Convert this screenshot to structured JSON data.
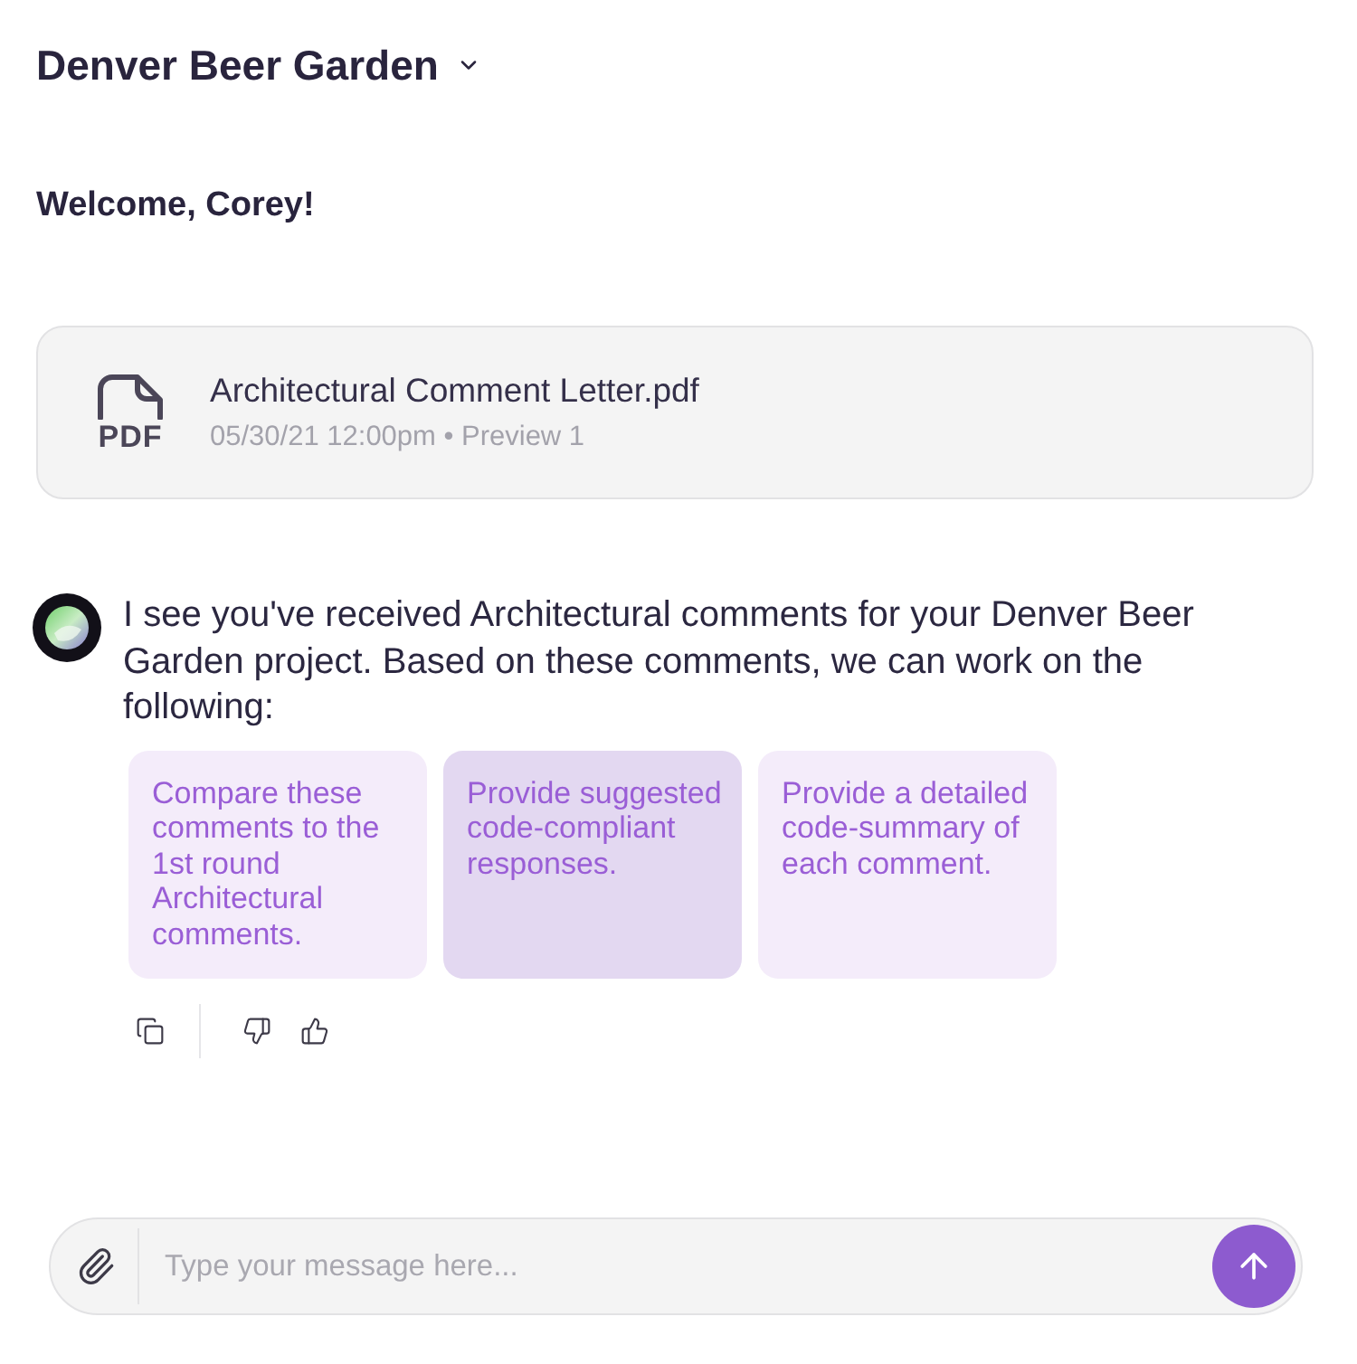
{
  "header": {
    "title": "Denver Beer Garden"
  },
  "welcome": "Welcome, Corey!",
  "attachment": {
    "file_type": "PDF",
    "filename": "Architectural Comment Letter.pdf",
    "meta": "05/30/21 12:00pm • Preview 1"
  },
  "message": {
    "text": "I see you've received Architectural comments for your Denver Beer Garden project. Based on these comments, we can work on the following:"
  },
  "suggestions": [
    {
      "text": "Compare these comments to the 1st round Architectural comments.",
      "selected": false
    },
    {
      "text": "Provide suggested code-compliant responses.",
      "selected": true
    },
    {
      "text": "Provide a detailed code-summary of each comment.",
      "selected": false
    }
  ],
  "composer": {
    "placeholder": "Type your message here..."
  }
}
